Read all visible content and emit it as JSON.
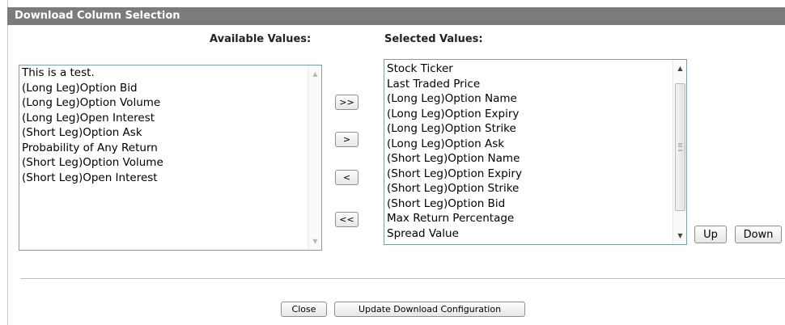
{
  "panel": {
    "title": "Download Column Selection"
  },
  "available": {
    "header": "Available Values:",
    "items": [
      "This is a test.",
      "(Long Leg)Option Bid",
      "(Long Leg)Option Volume",
      "(Long Leg)Open Interest",
      "(Short Leg)Option Ask",
      "Probability of Any Return",
      "(Short Leg)Option Volume",
      "(Short Leg)Open Interest"
    ]
  },
  "selected": {
    "header": "Selected Values:",
    "items": [
      "Stock Ticker",
      "Last Traded Price",
      "(Long Leg)Option Name",
      "(Long Leg)Option Expiry",
      "(Long Leg)Option Strike",
      "(Long Leg)Option Ask",
      "(Short Leg)Option Name",
      "(Short Leg)Option Expiry",
      "(Short Leg)Option Strike",
      "(Short Leg)Option Bid",
      "Max Return Percentage",
      "Spread Value"
    ]
  },
  "transfer": {
    "add_all": ">>",
    "add": ">",
    "remove": "<",
    "remove_all": "<<"
  },
  "order": {
    "up": "Up",
    "down": "Down"
  },
  "footer": {
    "close": "Close",
    "update": "Update Download Configuration"
  }
}
